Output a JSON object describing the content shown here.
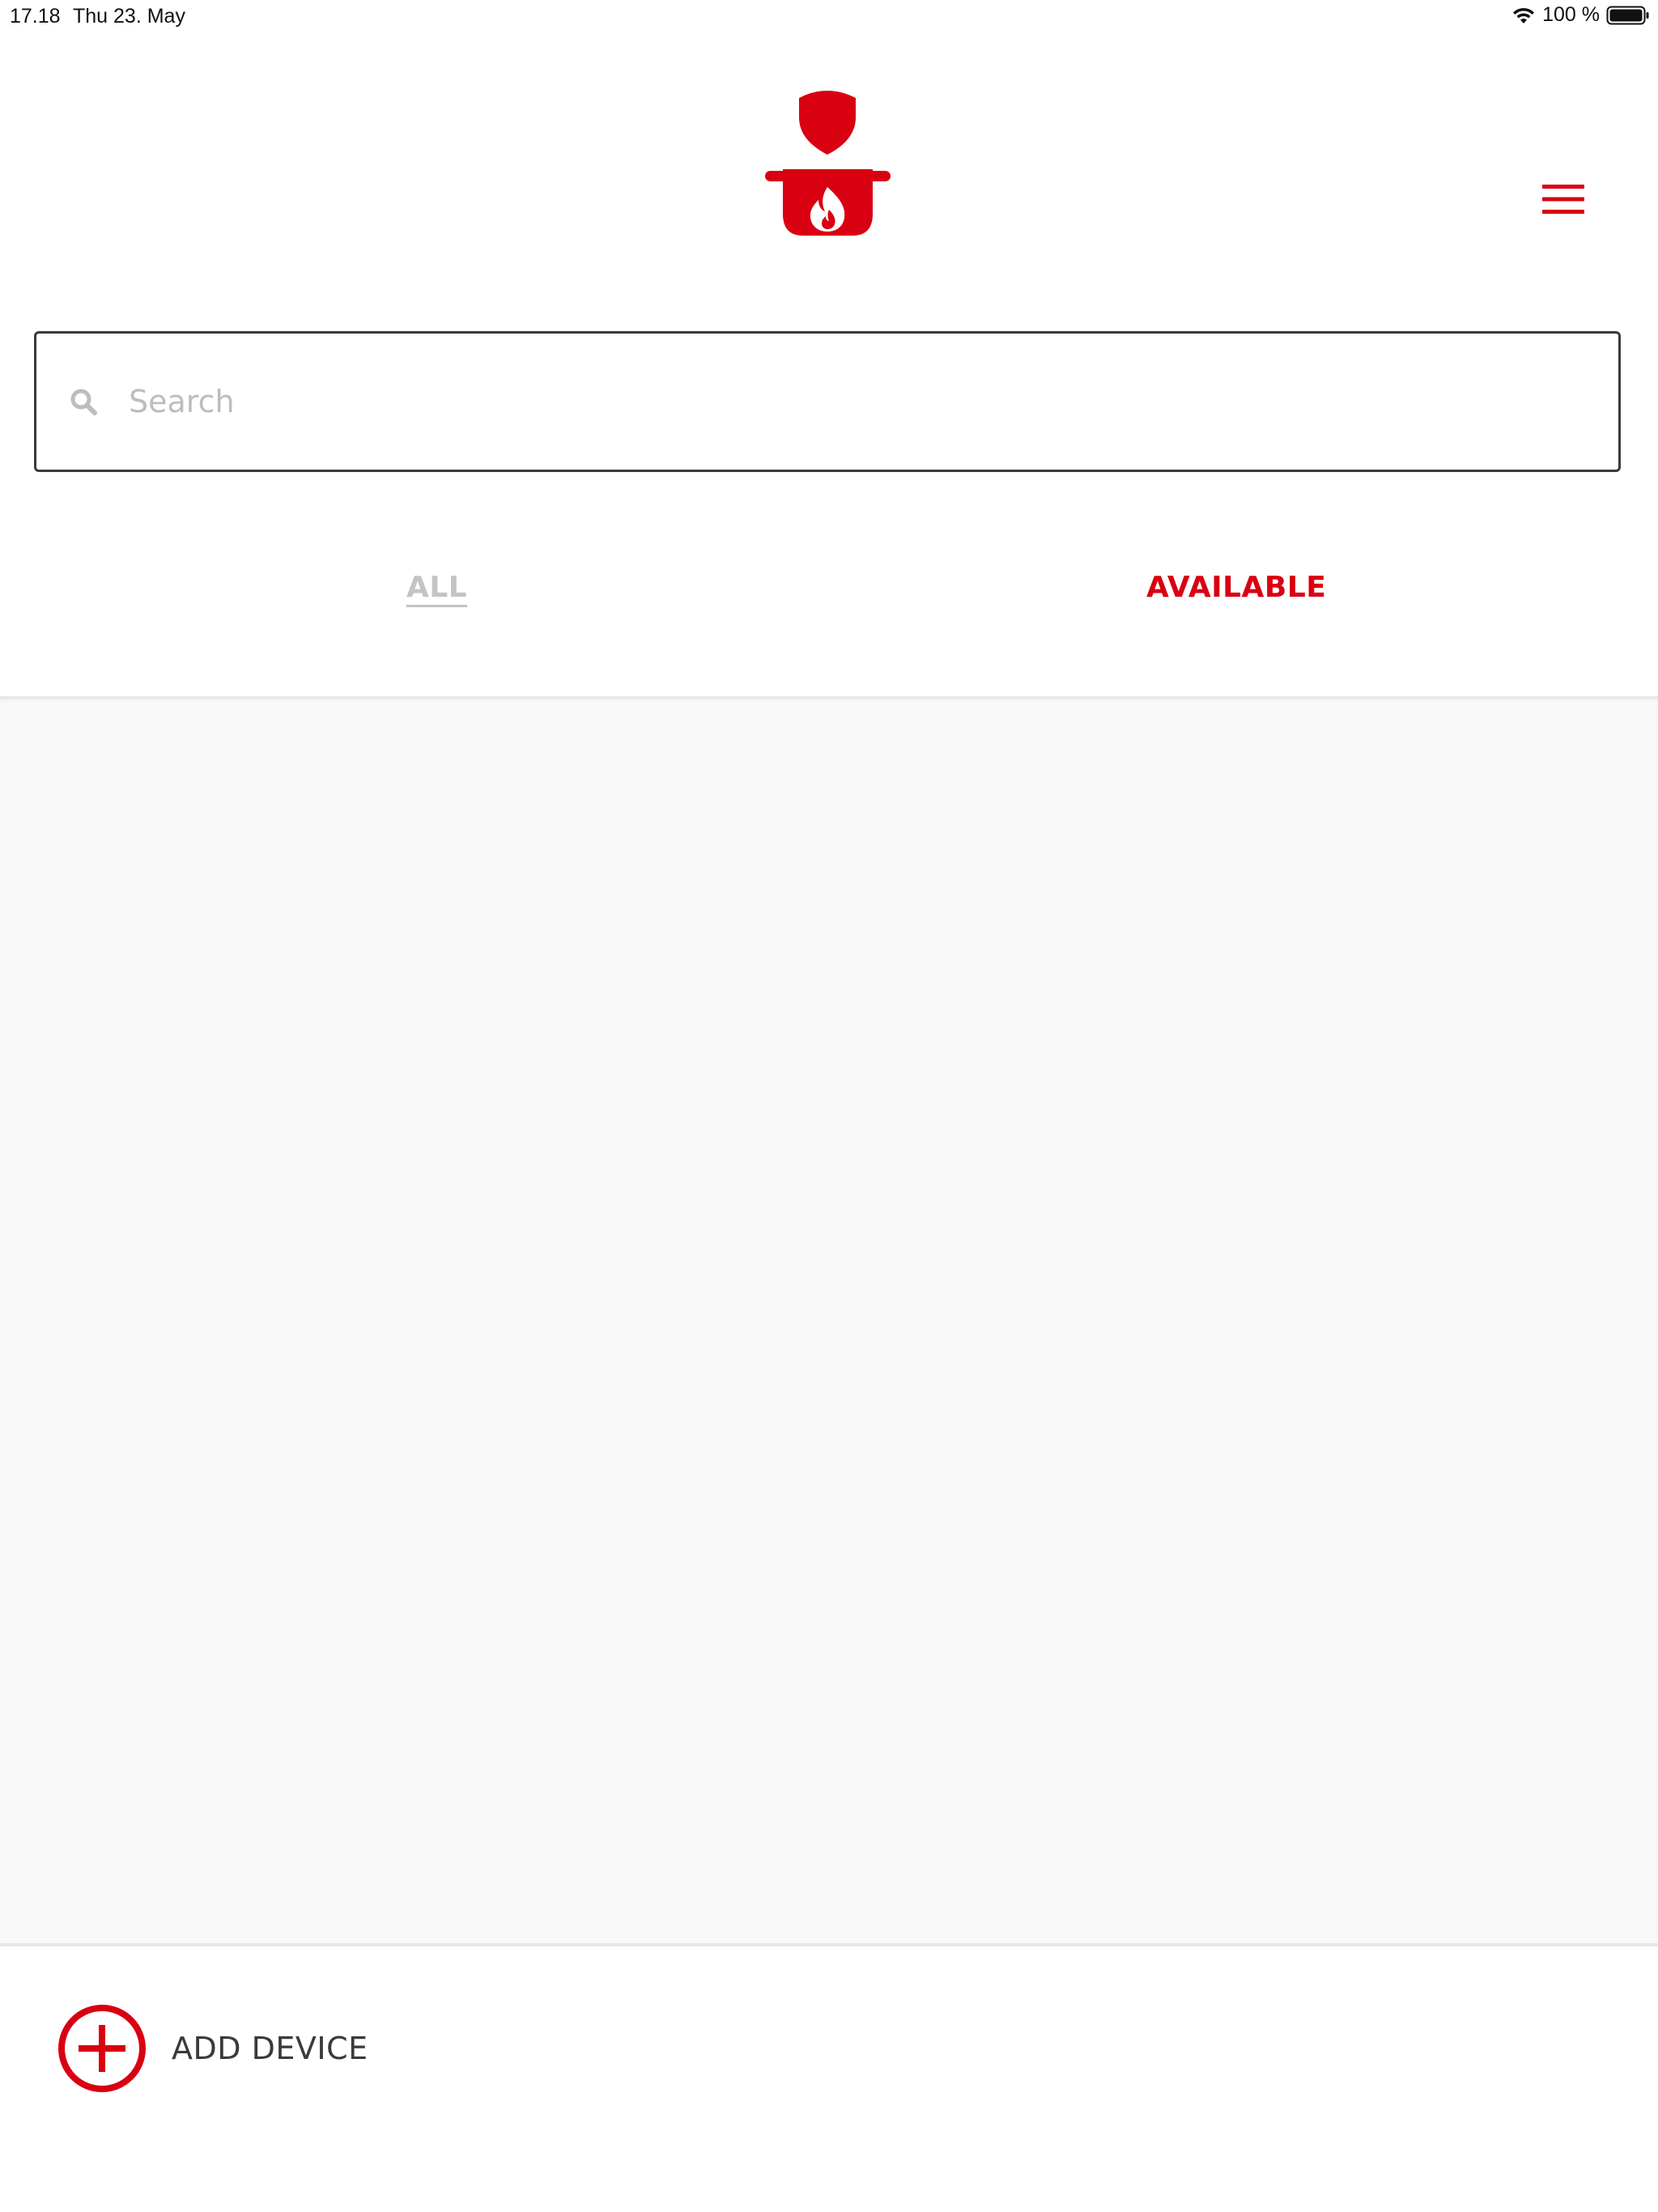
{
  "status_bar": {
    "time": "17.18",
    "date": "Thu 23. May",
    "battery": "100 %"
  },
  "header": {
    "logo_icon": "chef-pot-flame-logo",
    "menu_icon": "hamburger-menu-icon"
  },
  "search": {
    "placeholder": "Search",
    "value": ""
  },
  "tabs": [
    {
      "label": "ALL",
      "active": false
    },
    {
      "label": "AVAILABLE",
      "active": true
    }
  ],
  "footer": {
    "add_device_label": "ADD DEVICE",
    "add_icon": "plus-circle-icon"
  },
  "colors": {
    "accent": "#d90012",
    "tab_inactive": "#c4c4c4",
    "content_background": "#f8f8f8",
    "text_dark": "#3a3a3a"
  }
}
